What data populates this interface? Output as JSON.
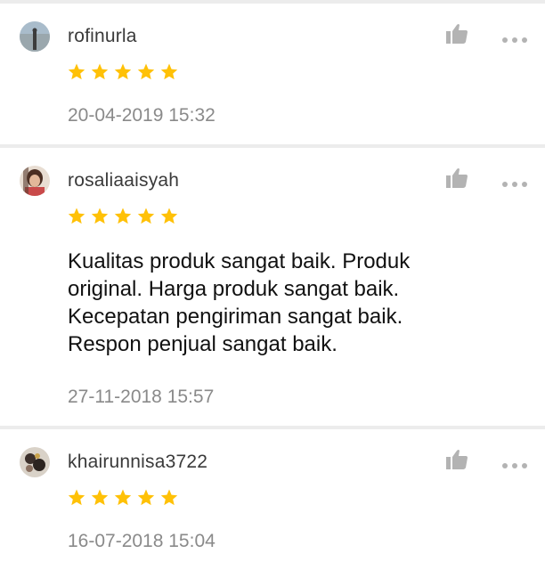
{
  "reviews": [
    {
      "username": "rofinurla",
      "rating": 5,
      "text": "",
      "date": "20-04-2019 15:32",
      "avatar_icon": "avatar-photo"
    },
    {
      "username": "rosaliaaisyah",
      "rating": 5,
      "text": " Kualitas produk sangat baik. Produk\noriginal. Harga produk sangat baik.\nKecepatan pengiriman sangat baik.\nRespon penjual sangat baik.",
      "date": "27-11-2018 15:57",
      "avatar_icon": "avatar-photo"
    },
    {
      "username": "khairunnisa3722",
      "rating": 5,
      "text": "",
      "date": "16-07-2018 15:04",
      "avatar_icon": "avatar-photo"
    }
  ],
  "icons": {
    "like": "thumbs-up-icon",
    "more": "more-options-icon",
    "star": "star-icon"
  },
  "colors": {
    "star": "#ffc107",
    "username": "#3a3a3a",
    "timestamp": "#8a8a8a",
    "text": "#111111",
    "icon": "#b3b3b3",
    "divider": "#ececec"
  }
}
